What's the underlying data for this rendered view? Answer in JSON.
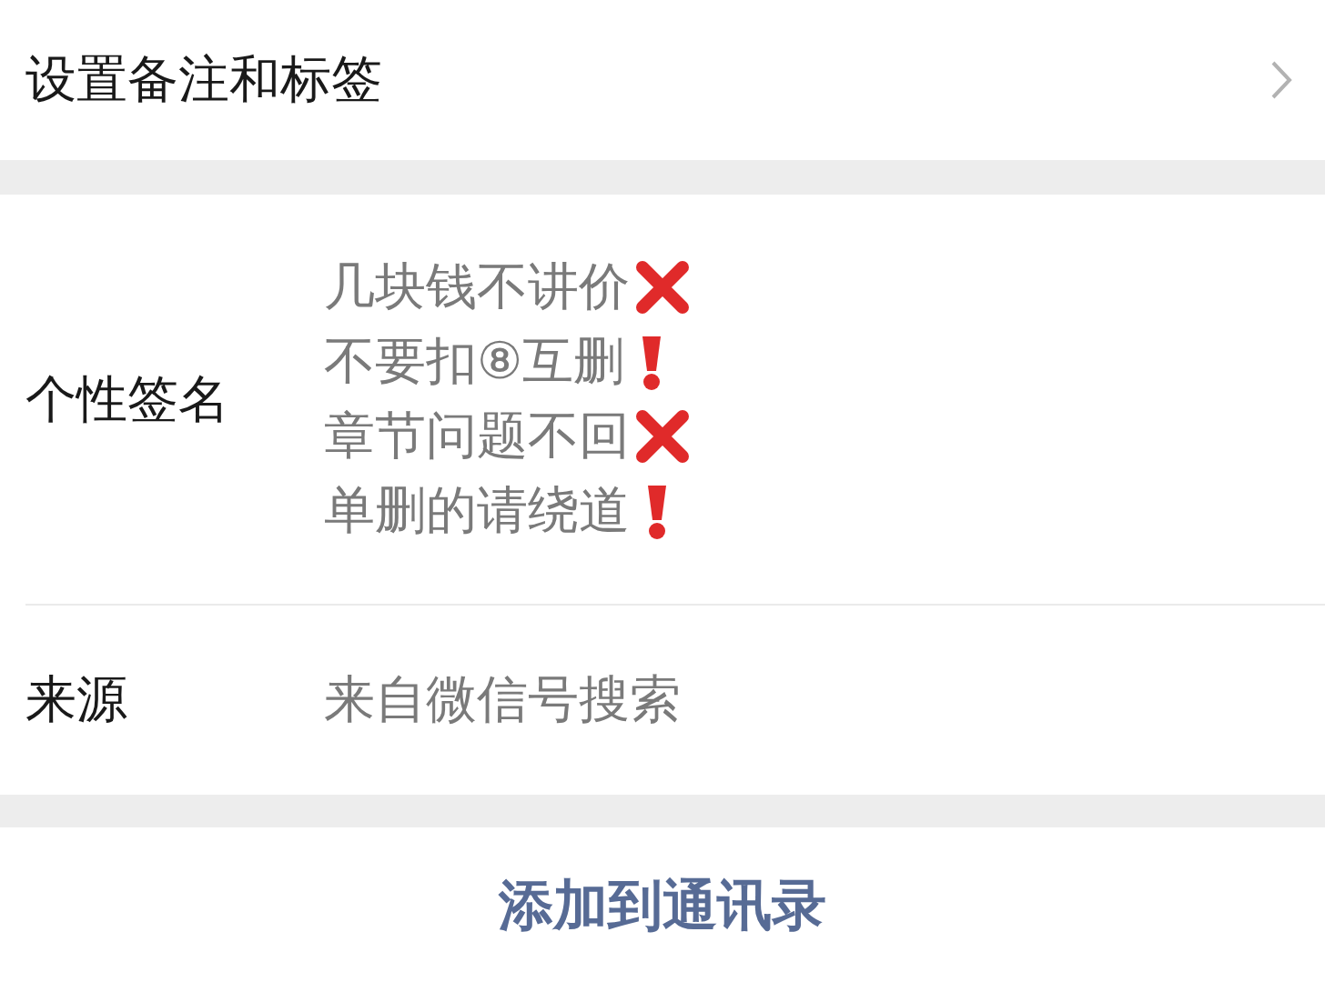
{
  "remark_row": {
    "label": "设置备注和标签"
  },
  "signature": {
    "label": "个性签名",
    "lines": [
      {
        "text": "几块钱不讲价",
        "kind": "cross"
      },
      {
        "text": "不要扣⑧互删",
        "kind": "exclamation"
      },
      {
        "text": "章节问题不回",
        "kind": "cross"
      },
      {
        "text": "单删的请绕道",
        "kind": "exclamation"
      }
    ]
  },
  "source": {
    "label": "来源",
    "value": "来自微信号搜索"
  },
  "add_button": {
    "label": "添加到通讯录"
  }
}
